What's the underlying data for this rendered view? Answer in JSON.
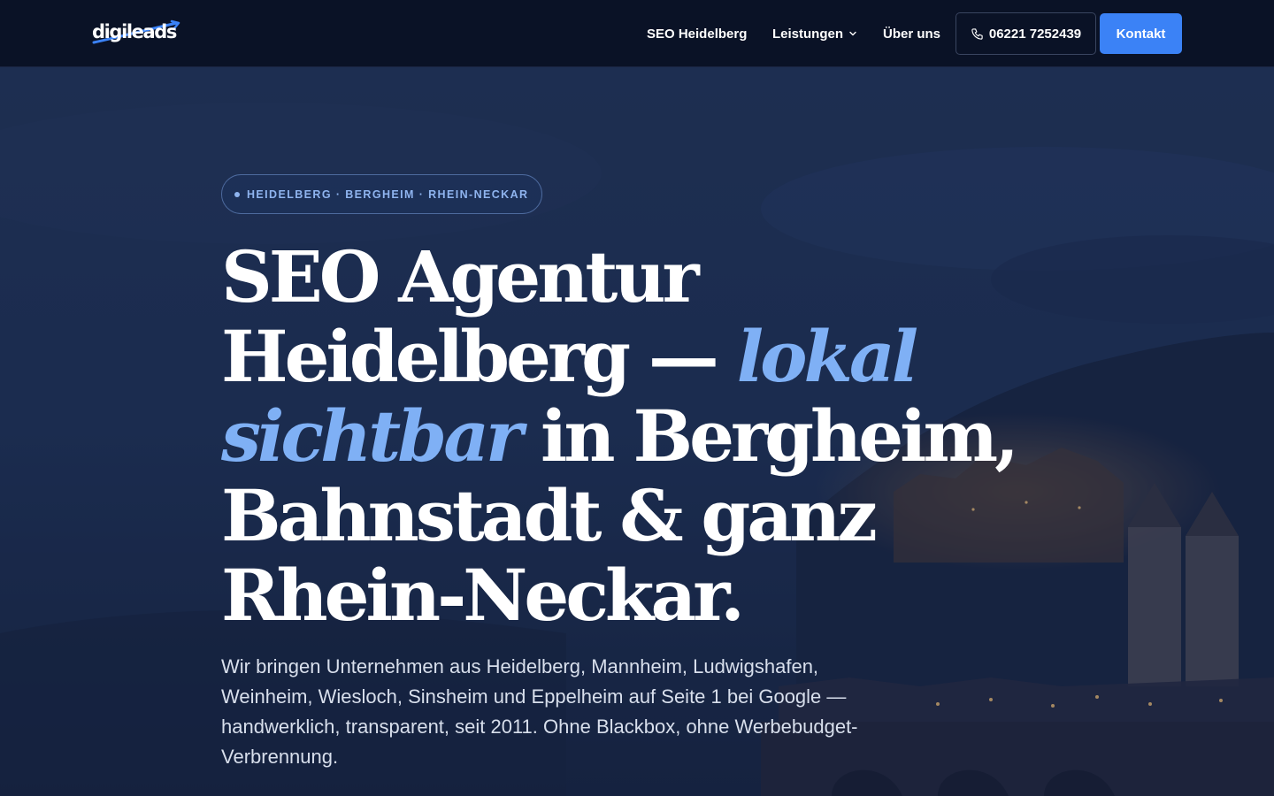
{
  "brand": {
    "logo_text": "digileads"
  },
  "nav": {
    "items": [
      {
        "label": "SEO Heidelberg"
      },
      {
        "label": "Leistungen",
        "has_dropdown": true
      },
      {
        "label": "Über uns"
      }
    ],
    "phone": "06221 7252439",
    "cta": "Kontakt"
  },
  "hero": {
    "badge": "HEIDELBERG · BERGHEIM · RHEIN-NECKAR",
    "headline": {
      "part1": "SEO Agentur Heidelberg — ",
      "accent": "lokal sichtbar",
      "part2": " in Bergheim, Bahnstadt & ganz Rhein-Neckar."
    },
    "lead": "Wir bringen Unternehmen aus Heidelberg, Mannheim, Ludwigshafen, Weinheim, Wiesloch, Sinsheim und Eppelheim auf Seite 1 bei Google — handwerklich, transparent, seit 2011. Ohne Blackbox, ohne Werbebudget-Verbrennung."
  },
  "colors": {
    "nav_bg": "#0a1226",
    "accent": "#3b82f6",
    "headline_accent": "#7fb0f5",
    "badge_text": "#8fb4ef"
  },
  "icons": [
    "phone-icon",
    "chevron-down-icon",
    "logo-swoosh-icon"
  ]
}
